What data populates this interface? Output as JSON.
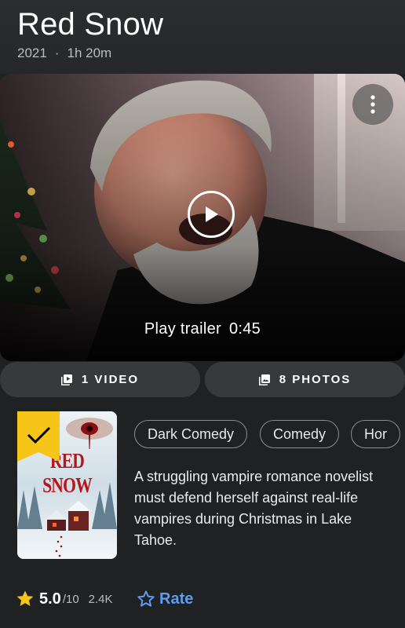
{
  "title": "Red Snow",
  "meta": {
    "year": "2021",
    "separator": "·",
    "runtime": "1h 20m"
  },
  "trailer": {
    "label": "Play trailer",
    "duration": "0:45"
  },
  "media": {
    "videos": "1 VIDEO",
    "photos": "8 PHOTOS"
  },
  "poster": {
    "title_text": "RED SNOW",
    "watchlisted": true
  },
  "genres": [
    "Dark Comedy",
    "Comedy",
    "Hor"
  ],
  "description": "A struggling vampire romance novelist must defend herself against real-life vampires during Christmas in Lake Tahoe.",
  "rating": {
    "score": "5.0",
    "out_of": "/10",
    "count": "2.4K"
  },
  "rate_label": "Rate",
  "colors": {
    "star": "#f5c518",
    "rate_blue": "#5c9ded",
    "ribbon": "#f5c518"
  },
  "icons": [
    "more-vert-icon",
    "play-icon",
    "video-library-icon",
    "photo-library-icon",
    "checkmark-icon",
    "star-icon",
    "star-outline-icon"
  ]
}
